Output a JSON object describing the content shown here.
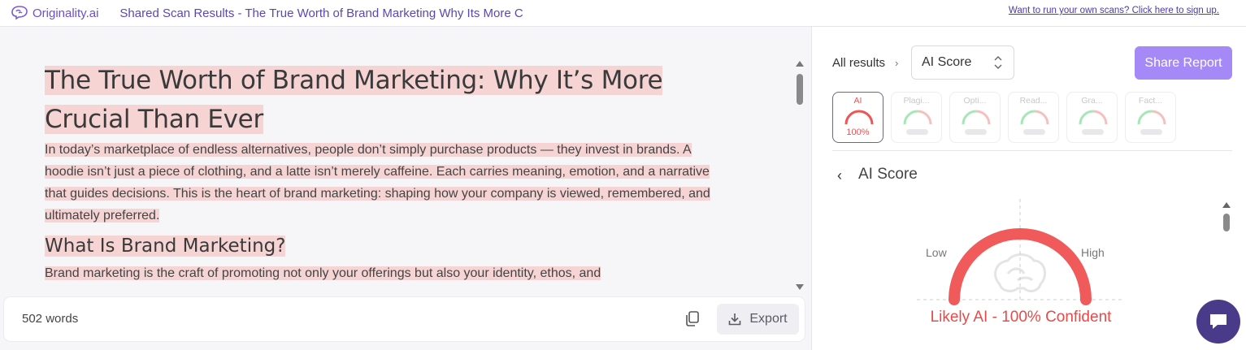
{
  "topbar": {
    "logo_text": "Originality.ai",
    "title": "Shared Scan Results - The True Worth of Brand Marketing Why Its More C",
    "signup_link": "Want to run your own scans? Click here to sign up."
  },
  "document": {
    "heading_1": "The True Worth of Brand Marketing: Why It’s More Crucial Than Ever",
    "paragraph_1": "In today’s marketplace of endless alternatives, people don’t simply purchase products — they invest in brands. A hoodie isn’t just a piece of clothing, and a latte isn’t merely caffeine. Each carries meaning, emotion, and a narrative that guides decisions. This is the heart of brand marketing: shaping how your company is viewed, remembered, and ultimately preferred.",
    "heading_2": "What Is Brand Marketing?",
    "paragraph_2": "Brand marketing is the craft of promoting not only your offerings but also your identity, ethos, and"
  },
  "footer": {
    "word_count": "502 words",
    "export_label": "Export"
  },
  "results": {
    "breadcrumb_all": "All results",
    "selected_score": "AI Score",
    "share_label": "Share Report",
    "tabs": [
      {
        "label": "AI",
        "value": "100%"
      },
      {
        "label": "Plagi..."
      },
      {
        "label": "Opti..."
      },
      {
        "label": "Read..."
      },
      {
        "label": "Gra..."
      },
      {
        "label": "Fact..."
      }
    ],
    "section_title": "AI Score",
    "gauge": {
      "low_label": "Low",
      "high_label": "High",
      "result": "Likely AI - 100% Confident",
      "level": 1.0,
      "color": "#f05a5a"
    }
  },
  "colors": {
    "accent": "#a589f6",
    "highlight": "#f6d4d4",
    "ai_red": "#e74a4a",
    "chat_button": "#4a3a8a"
  }
}
